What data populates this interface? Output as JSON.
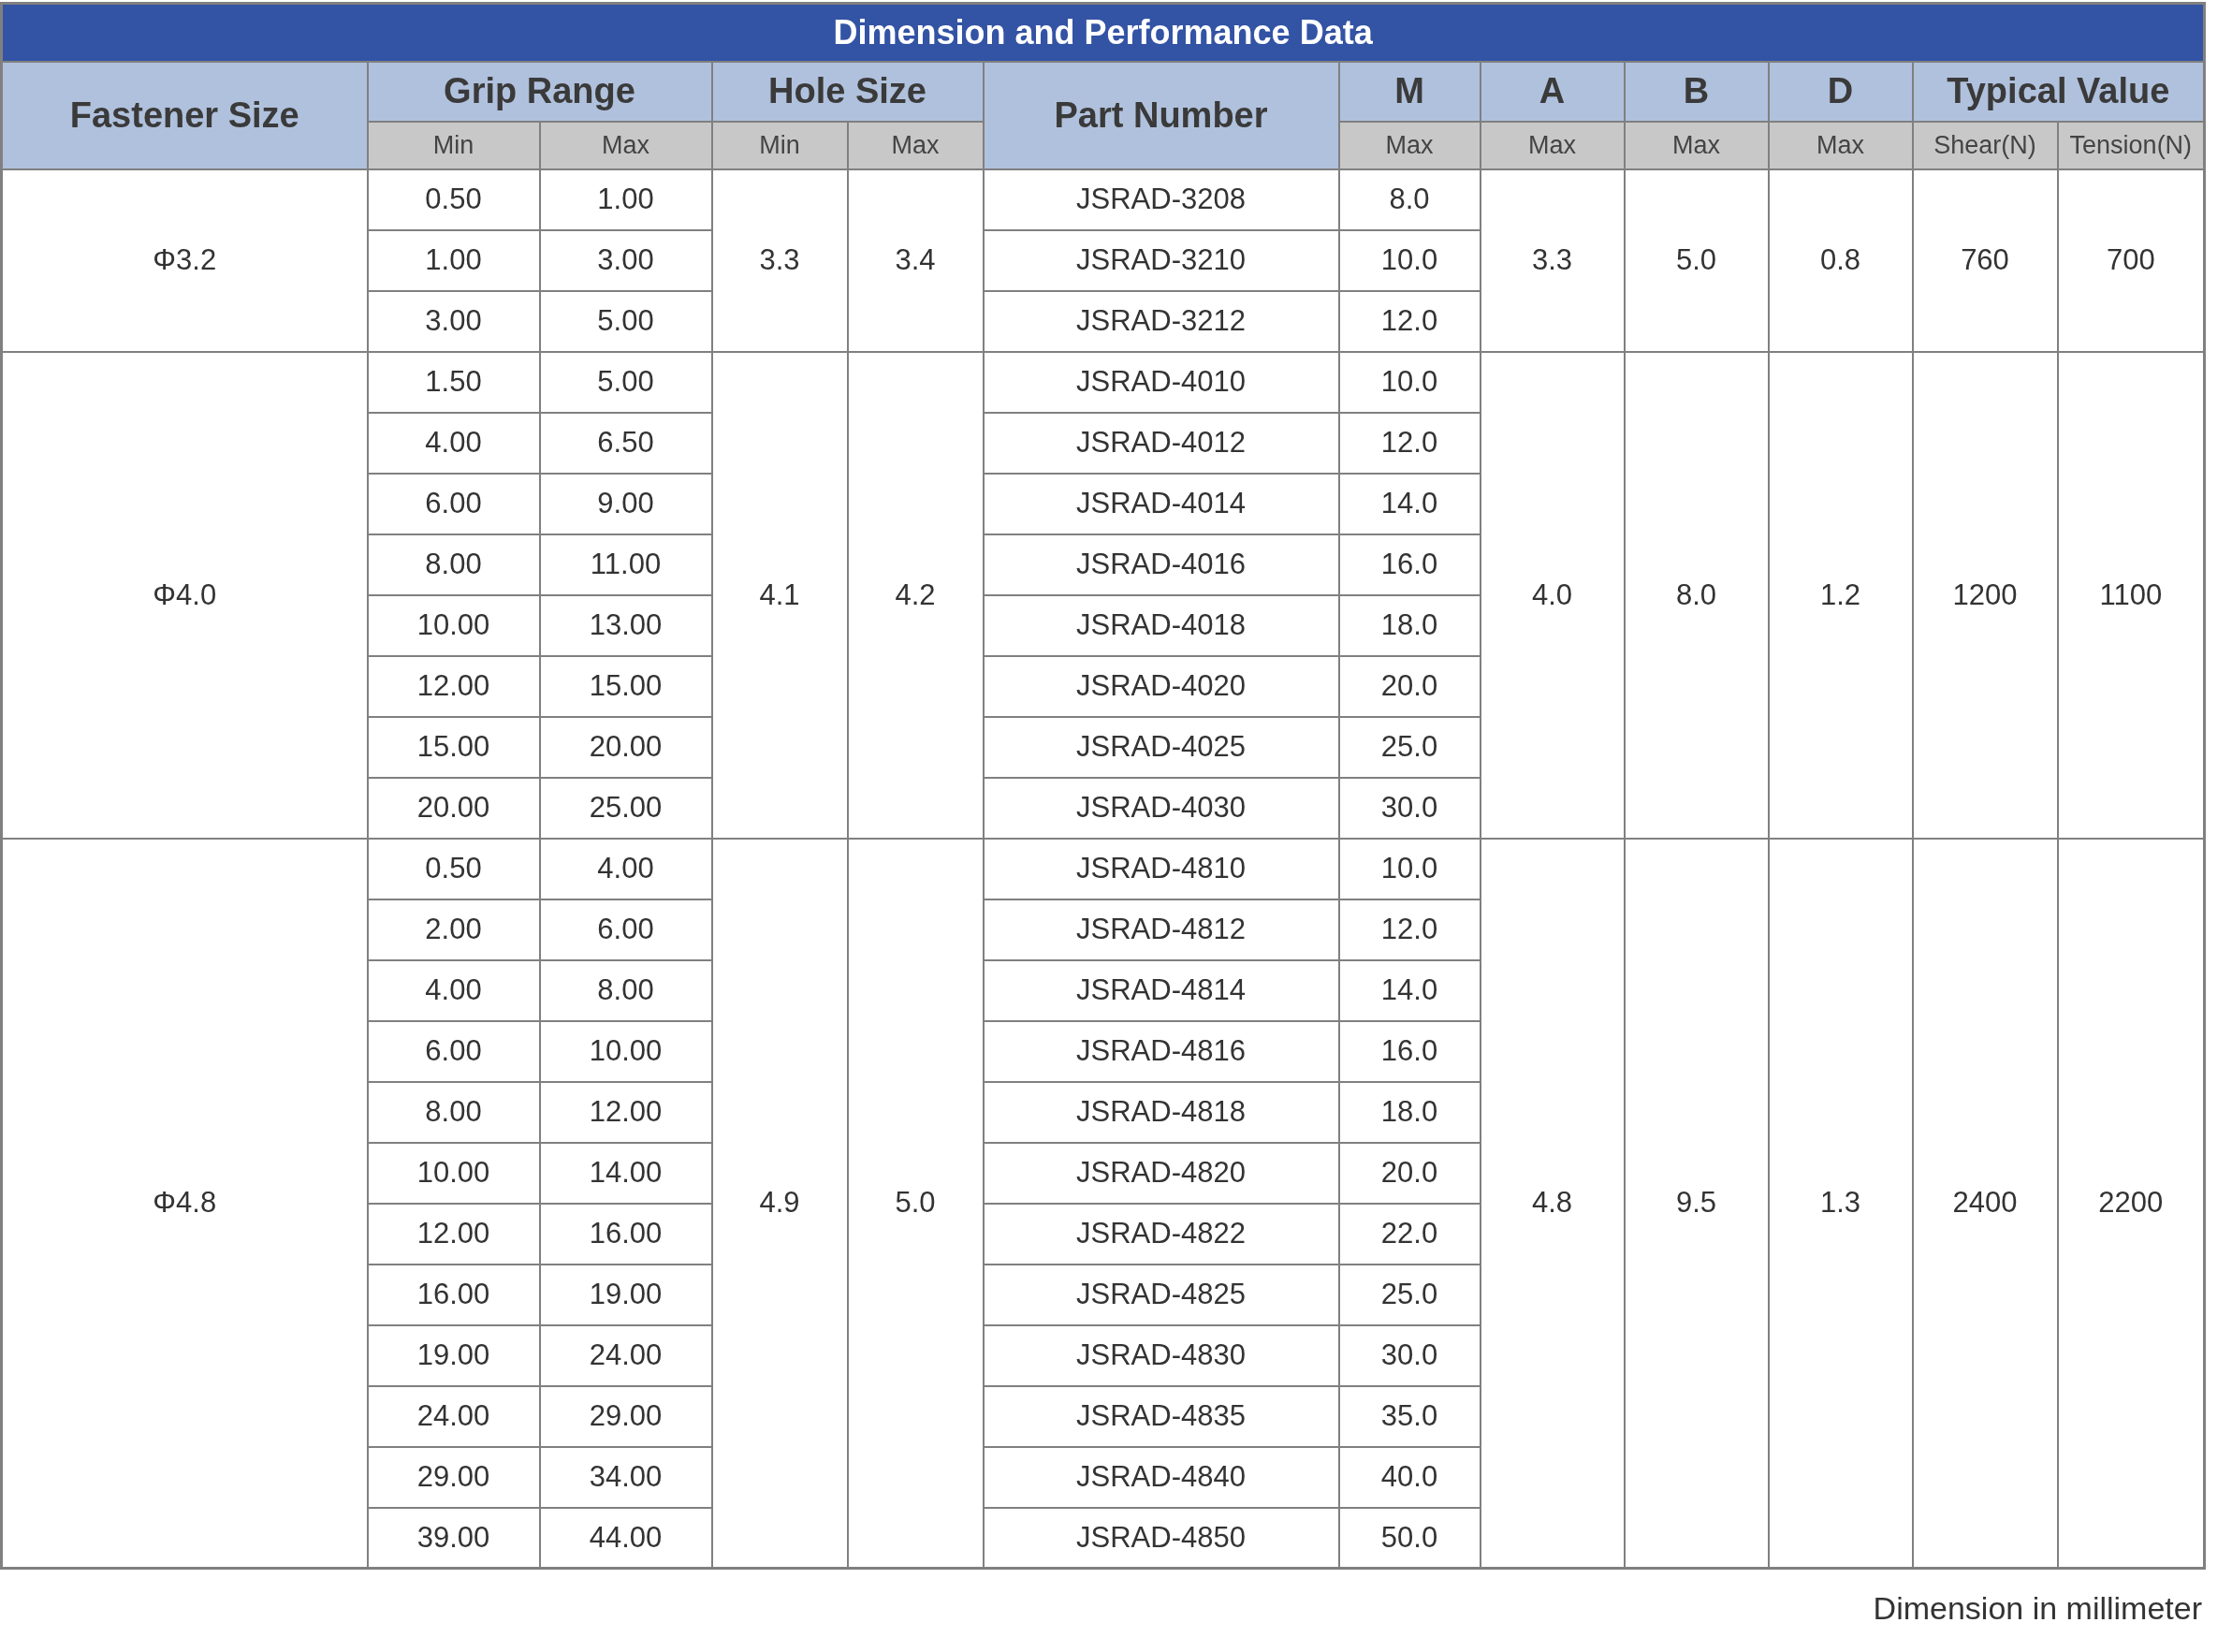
{
  "table": {
    "title": "Dimension and Performance Data",
    "header_groups": [
      {
        "label": "Fastener Size"
      },
      {
        "label": "Grip Range",
        "subs": [
          "Min",
          "Max"
        ]
      },
      {
        "label": "Hole Size",
        "subs": [
          "Min",
          "Max"
        ]
      },
      {
        "label": "Part Number"
      },
      {
        "label": "M",
        "subs": [
          "Max"
        ]
      },
      {
        "label": "A",
        "subs": [
          "Max"
        ]
      },
      {
        "label": "B",
        "subs": [
          "Max"
        ]
      },
      {
        "label": "D",
        "subs": [
          "Max"
        ]
      },
      {
        "label": "Typical Value",
        "subs": [
          "Shear(N)",
          "Tension(N)"
        ]
      }
    ],
    "groups": [
      {
        "fastener_size": "Φ3.2",
        "hole_min": "3.3",
        "hole_max": "3.4",
        "a": "3.3",
        "b": "5.0",
        "d": "0.8",
        "shear": "760",
        "tension": "700",
        "rows": [
          {
            "grip_min": "0.50",
            "grip_max": "1.00",
            "part_number": "JSRAD-3208",
            "m": "8.0"
          },
          {
            "grip_min": "1.00",
            "grip_max": "3.00",
            "part_number": "JSRAD-3210",
            "m": "10.0"
          },
          {
            "grip_min": "3.00",
            "grip_max": "5.00",
            "part_number": "JSRAD-3212",
            "m": "12.0"
          }
        ]
      },
      {
        "fastener_size": "Φ4.0",
        "hole_min": "4.1",
        "hole_max": "4.2",
        "a": "4.0",
        "b": "8.0",
        "d": "1.2",
        "shear": "1200",
        "tension": "1100",
        "rows": [
          {
            "grip_min": "1.50",
            "grip_max": "5.00",
            "part_number": "JSRAD-4010",
            "m": "10.0"
          },
          {
            "grip_min": "4.00",
            "grip_max": "6.50",
            "part_number": "JSRAD-4012",
            "m": "12.0"
          },
          {
            "grip_min": "6.00",
            "grip_max": "9.00",
            "part_number": "JSRAD-4014",
            "m": "14.0"
          },
          {
            "grip_min": "8.00",
            "grip_max": "11.00",
            "part_number": "JSRAD-4016",
            "m": "16.0"
          },
          {
            "grip_min": "10.00",
            "grip_max": "13.00",
            "part_number": "JSRAD-4018",
            "m": "18.0"
          },
          {
            "grip_min": "12.00",
            "grip_max": "15.00",
            "part_number": "JSRAD-4020",
            "m": "20.0"
          },
          {
            "grip_min": "15.00",
            "grip_max": "20.00",
            "part_number": "JSRAD-4025",
            "m": "25.0"
          },
          {
            "grip_min": "20.00",
            "grip_max": "25.00",
            "part_number": "JSRAD-4030",
            "m": "30.0"
          }
        ]
      },
      {
        "fastener_size": "Φ4.8",
        "hole_min": "4.9",
        "hole_max": "5.0",
        "a": "4.8",
        "b": "9.5",
        "d": "1.3",
        "shear": "2400",
        "tension": "2200",
        "rows": [
          {
            "grip_min": "0.50",
            "grip_max": "4.00",
            "part_number": "JSRAD-4810",
            "m": "10.0"
          },
          {
            "grip_min": "2.00",
            "grip_max": "6.00",
            "part_number": "JSRAD-4812",
            "m": "12.0"
          },
          {
            "grip_min": "4.00",
            "grip_max": "8.00",
            "part_number": "JSRAD-4814",
            "m": "14.0"
          },
          {
            "grip_min": "6.00",
            "grip_max": "10.00",
            "part_number": "JSRAD-4816",
            "m": "16.0"
          },
          {
            "grip_min": "8.00",
            "grip_max": "12.00",
            "part_number": "JSRAD-4818",
            "m": "18.0"
          },
          {
            "grip_min": "10.00",
            "grip_max": "14.00",
            "part_number": "JSRAD-4820",
            "m": "20.0"
          },
          {
            "grip_min": "12.00",
            "grip_max": "16.00",
            "part_number": "JSRAD-4822",
            "m": "22.0"
          },
          {
            "grip_min": "16.00",
            "grip_max": "19.00",
            "part_number": "JSRAD-4825",
            "m": "25.0"
          },
          {
            "grip_min": "19.00",
            "grip_max": "24.00",
            "part_number": "JSRAD-4830",
            "m": "30.0"
          },
          {
            "grip_min": "24.00",
            "grip_max": "29.00",
            "part_number": "JSRAD-4835",
            "m": "35.0"
          },
          {
            "grip_min": "29.00",
            "grip_max": "34.00",
            "part_number": "JSRAD-4840",
            "m": "40.0"
          },
          {
            "grip_min": "39.00",
            "grip_max": "44.00",
            "part_number": "JSRAD-4850",
            "m": "50.0"
          }
        ]
      }
    ],
    "footnote": "Dimension in millimeter"
  }
}
